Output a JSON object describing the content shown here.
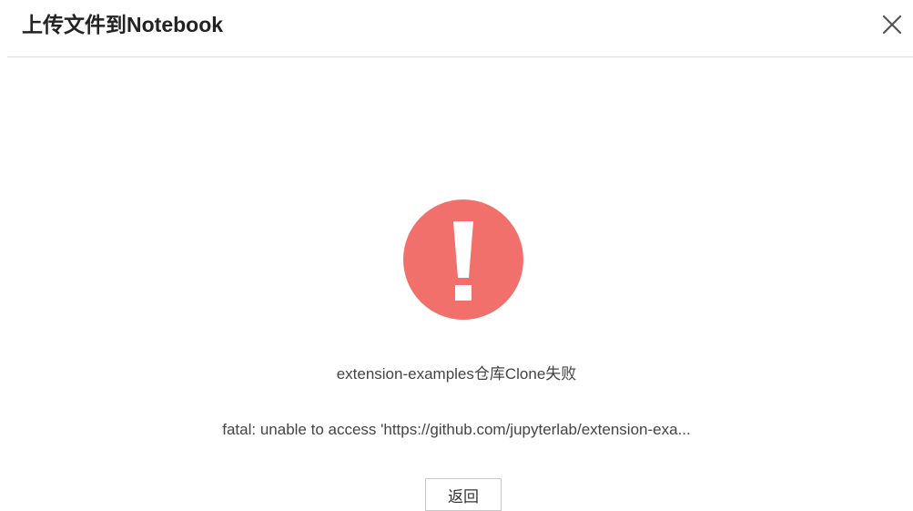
{
  "dialog": {
    "title": "上传文件到Notebook",
    "close_icon": "close-icon"
  },
  "error": {
    "icon": "exclamation-circle-icon",
    "icon_color": "#f2706b",
    "title": "extension-examples仓库Clone失败",
    "detail": "fatal: unable to access 'https://github.com/jupyterlab/extension-exa..."
  },
  "actions": {
    "back_label": "返回"
  }
}
